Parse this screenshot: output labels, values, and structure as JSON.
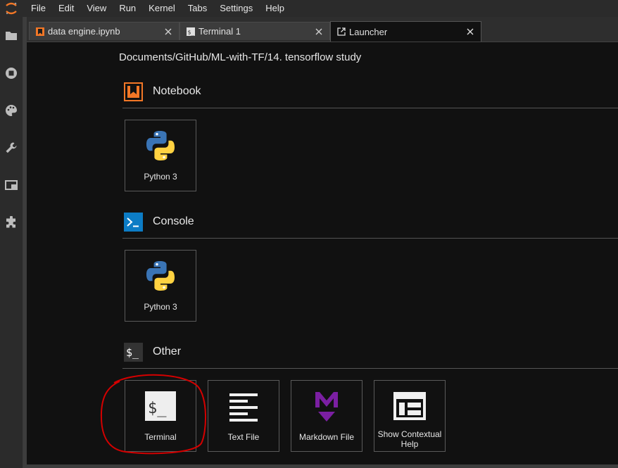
{
  "menu": {
    "items": [
      "File",
      "Edit",
      "View",
      "Run",
      "Kernel",
      "Tabs",
      "Settings",
      "Help"
    ]
  },
  "sidebar": {
    "icons": [
      "folder-icon",
      "running-icon",
      "palette-icon",
      "wrench-icon",
      "tabs-icon",
      "extension-icon"
    ]
  },
  "tabs": [
    {
      "label": "data engine.ipynb",
      "icon": "notebook-icon",
      "active": false
    },
    {
      "label": "Terminal 1",
      "icon": "terminal-icon",
      "active": false
    },
    {
      "label": "Launcher",
      "icon": "launcher-icon",
      "active": true
    }
  ],
  "launcher": {
    "cwd": "Documents/GitHub/ML-with-TF/14. tensorflow study",
    "sections": {
      "notebook": {
        "title": "Notebook",
        "cards": [
          {
            "label": "Python 3"
          }
        ]
      },
      "console": {
        "title": "Console",
        "cards": [
          {
            "label": "Python 3"
          }
        ]
      },
      "other": {
        "title": "Other",
        "cards": [
          {
            "label": "Terminal"
          },
          {
            "label": "Text File"
          },
          {
            "label": "Markdown File"
          },
          {
            "label": "Show Contextual Help"
          }
        ]
      }
    }
  },
  "colors": {
    "notebook_orange": "#f37726",
    "console_blue": "#0c7cc5",
    "markdown_purple": "#7b1fa2",
    "annotation_red": "#d40000"
  }
}
